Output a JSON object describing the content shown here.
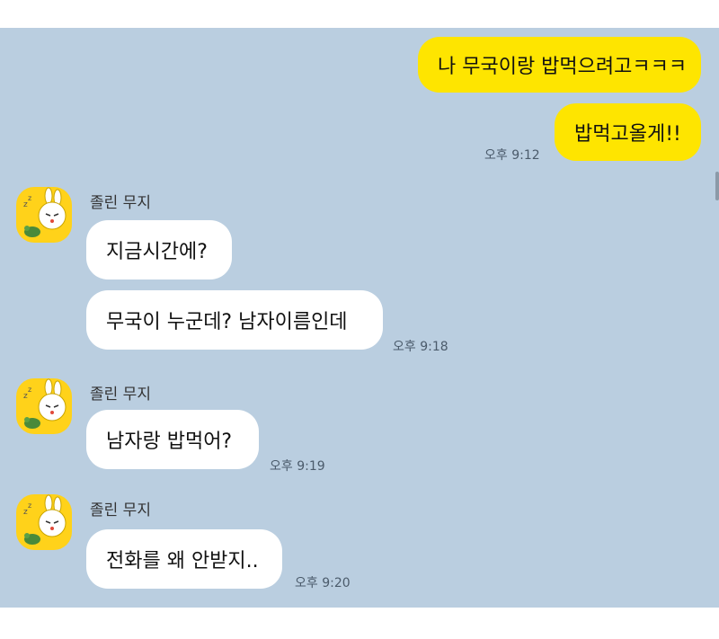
{
  "messages": [
    {
      "from": "me",
      "text": "나 무국이랑 밥먹으려고ㅋㅋㅋ"
    },
    {
      "from": "me",
      "text": "밥먹고올게!!",
      "time": "오후 9:12"
    },
    {
      "from": "other",
      "sender": "졸린 무지",
      "text": "지금시간에?"
    },
    {
      "from": "other",
      "text": "무국이 누군데? 남자이름인데",
      "time": "오후 9:18"
    },
    {
      "from": "other",
      "sender": "졸린 무지",
      "text": "남자랑 밥먹어?",
      "time": "오후 9:19"
    },
    {
      "from": "other",
      "sender": "졸린 무지",
      "text": "전화를 왜 안받지..",
      "time": "오후 9:20"
    }
  ],
  "avatar_icon": "muzi-rabbit-icon",
  "colors": {
    "chat_background": "#bacee0",
    "my_bubble": "#fee500",
    "their_bubble": "#ffffff",
    "avatar": "#ffd21a"
  }
}
